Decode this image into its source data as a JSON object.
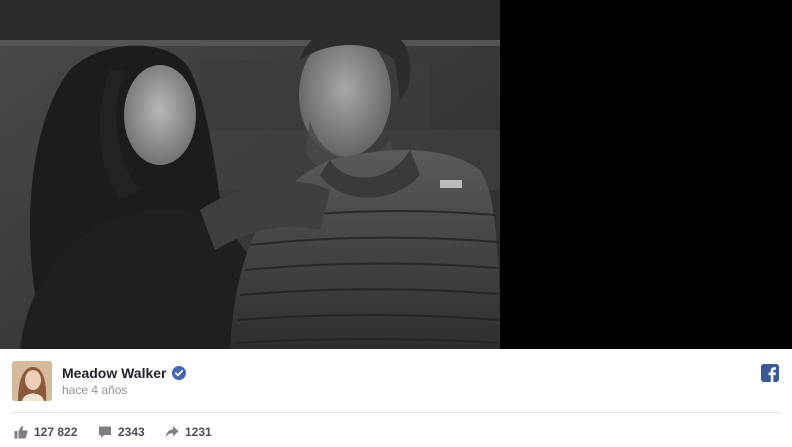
{
  "post": {
    "author": "Meadow Walker",
    "time": "hace 4 años",
    "media_description": "black and white photo"
  },
  "stats": {
    "likes": "127 822",
    "comments": "2343",
    "shares": "1231"
  },
  "icons": {
    "verified": "verified-badge-icon",
    "facebook": "facebook-logo-icon",
    "like": "thumbs-up-icon",
    "comment": "comment-bubble-icon",
    "share": "share-arrow-icon"
  },
  "colors": {
    "facebook_blue": "#3b5998",
    "verified_blue": "#4267b2",
    "name_text": "#1d2129",
    "meta_text": "#90949c",
    "stat_text": "#4b4f56"
  }
}
